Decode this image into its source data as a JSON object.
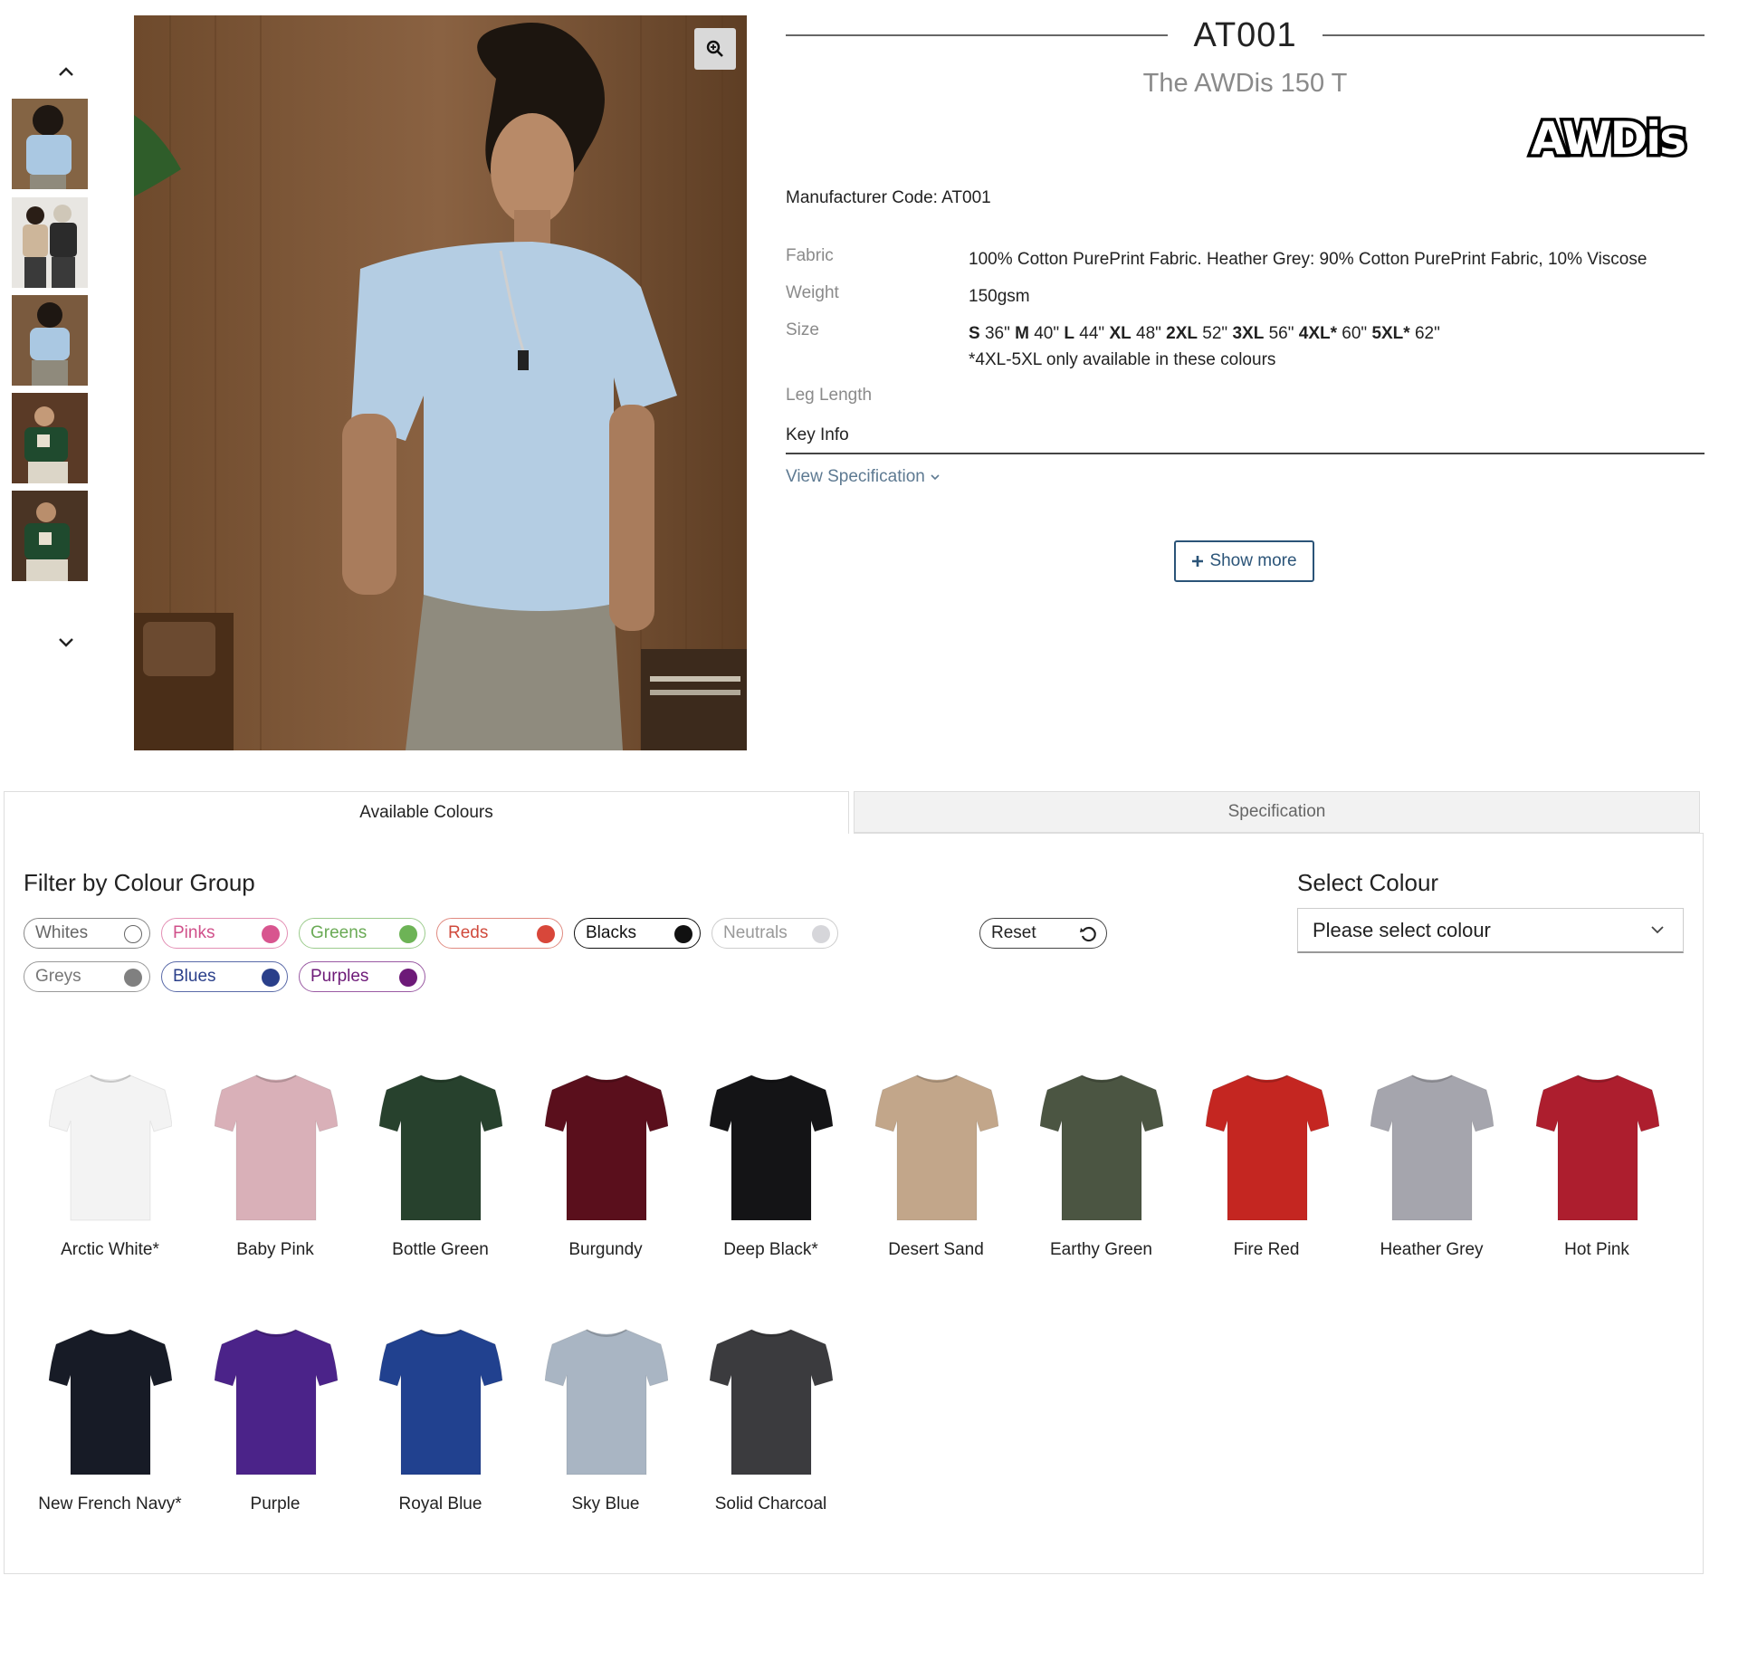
{
  "product": {
    "code": "AT001",
    "name": "The AWDis 150 T",
    "brand": "AWDis",
    "manufacturer_code": "Manufacturer Code: AT001",
    "fabric_label": "Fabric",
    "fabric_value": "100% Cotton PurePrint Fabric. Heather Grey: 90% Cotton PurePrint Fabric, 10% Viscose",
    "weight_label": "Weight",
    "weight_value": "150gsm",
    "size_label": "Size",
    "sizes": [
      {
        "size": "S",
        "chest": "36\""
      },
      {
        "size": "M",
        "chest": "40\""
      },
      {
        "size": "L",
        "chest": "44\""
      },
      {
        "size": "XL",
        "chest": "48\""
      },
      {
        "size": "2XL",
        "chest": "52\""
      },
      {
        "size": "3XL",
        "chest": "56\""
      },
      {
        "size": "4XL*",
        "chest": "60\""
      },
      {
        "size": "5XL*",
        "chest": "62\""
      }
    ],
    "size_note": "*4XL-5XL only available in these colours",
    "leg_length_label": "Leg Length",
    "key_info": "Key Info",
    "view_spec": "View Specification",
    "show_more": "Show more"
  },
  "gallery": {
    "thumbnail_count": 5
  },
  "tabs": {
    "available_colours": "Available Colours",
    "specification": "Specification"
  },
  "filter": {
    "title": "Filter by Colour Group",
    "groups": [
      {
        "label": "Whites",
        "text_color": "#666666",
        "dot": "#ffffff",
        "border": "#888888"
      },
      {
        "label": "Pinks",
        "text_color": "#d0508a",
        "dot": "#d8558f",
        "border": "#e38fb4"
      },
      {
        "label": "Greens",
        "text_color": "#6aaa55",
        "dot": "#6db356",
        "border": "#9bcb8c"
      },
      {
        "label": "Reds",
        "text_color": "#d04a3c",
        "dot": "#d8473a",
        "border": "#e08a80"
      },
      {
        "label": "Blacks",
        "text_color": "#111111",
        "dot": "#111111",
        "border": "#111111"
      },
      {
        "label": "Neutrals",
        "text_color": "#999999",
        "dot": "#d6d6da",
        "border": "#cccccc"
      },
      {
        "label": "Greys",
        "text_color": "#777777",
        "dot": "#808080",
        "border": "#999999"
      },
      {
        "label": "Blues",
        "text_color": "#2a3f8a",
        "dot": "#2a3f8a",
        "border": "#5a6aa8"
      },
      {
        "label": "Purples",
        "text_color": "#6d1a78",
        "dot": "#6d1a78",
        "border": "#9a5aa3"
      }
    ],
    "reset": "Reset"
  },
  "select_colour": {
    "title": "Select Colour",
    "placeholder": "Please select colour"
  },
  "colours": [
    {
      "name": "Arctic White*",
      "hex": "#f3f3f3"
    },
    {
      "name": "Baby Pink",
      "hex": "#d9b0b8"
    },
    {
      "name": "Bottle Green",
      "hex": "#27412d"
    },
    {
      "name": "Burgundy",
      "hex": "#5a0f1c"
    },
    {
      "name": "Deep Black*",
      "hex": "#141416"
    },
    {
      "name": "Desert Sand",
      "hex": "#c2a68a"
    },
    {
      "name": "Earthy Green",
      "hex": "#4b5542"
    },
    {
      "name": "Fire Red",
      "hex": "#c42621"
    },
    {
      "name": "Heather Grey",
      "hex": "#a5a5ad"
    },
    {
      "name": "Hot Pink",
      "hex": "#ad1e2e"
    },
    {
      "name": "New French Navy*",
      "hex": "#171b26"
    },
    {
      "name": "Purple",
      "hex": "#4b2389"
    },
    {
      "name": "Royal Blue",
      "hex": "#21418f"
    },
    {
      "name": "Sky Blue",
      "hex": "#a9b5c3"
    },
    {
      "name": "Solid Charcoal",
      "hex": "#3b3b3e"
    }
  ]
}
